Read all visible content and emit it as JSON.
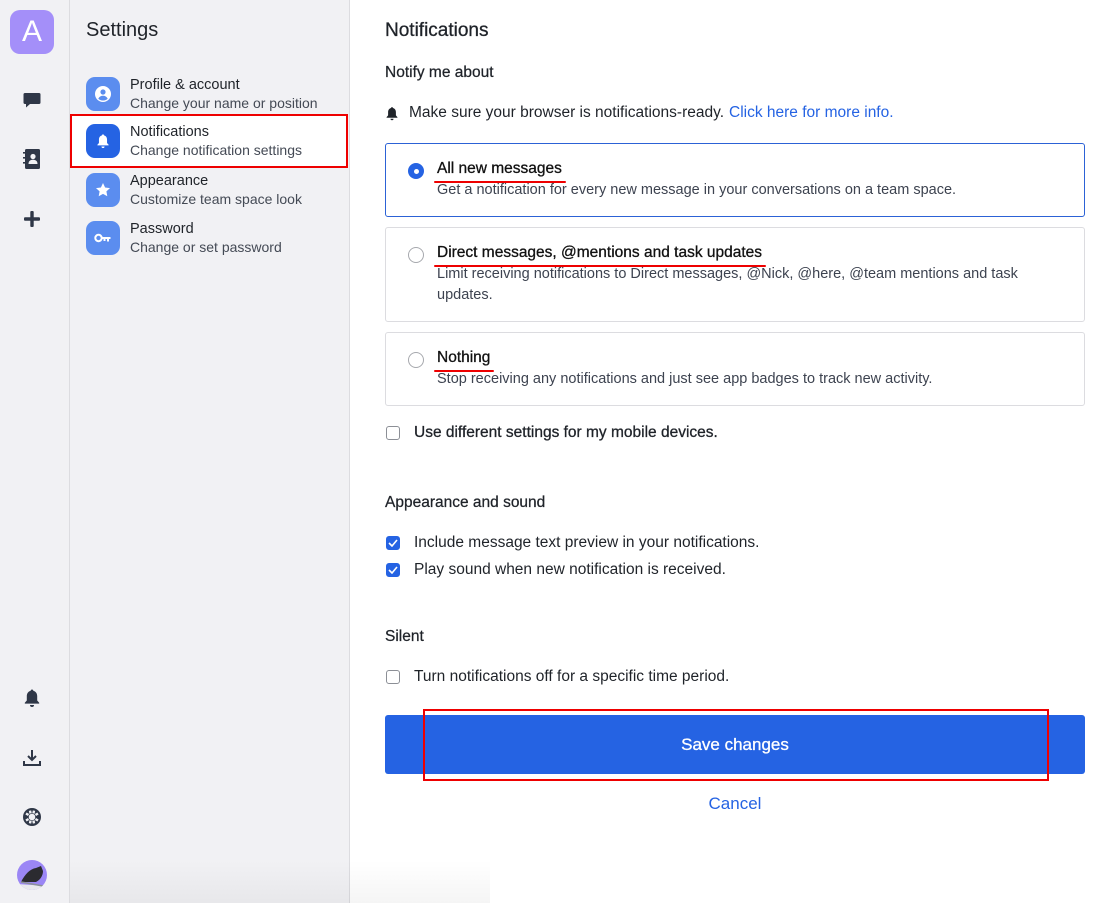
{
  "rail": {
    "workspace_initial": "A",
    "top_icons": [
      "chat-icon",
      "contacts-icon",
      "add-icon"
    ],
    "bottom_icons": [
      "bell-icon",
      "download-icon",
      "help-lifebuoy-icon",
      "user-avatar"
    ]
  },
  "settings": {
    "title": "Settings",
    "items": [
      {
        "label": "Profile & account",
        "sub": "Change your name or position",
        "icon": "user-icon"
      },
      {
        "label": "Notifications",
        "sub": "Change notification settings",
        "icon": "bell-icon",
        "active": true
      },
      {
        "label": "Appearance",
        "sub": "Customize team space look",
        "icon": "star-icon"
      },
      {
        "label": "Password",
        "sub": "Change or set password",
        "icon": "key-icon"
      }
    ]
  },
  "main": {
    "title": "Notifications",
    "notify_heading": "Notify me about",
    "hint_text": "Make sure your browser is notifications-ready.",
    "hint_link": "Click here for more info.",
    "options": [
      {
        "title": "All new messages",
        "desc": "Get a notification for every new message in your conversations on a team space.",
        "selected": true
      },
      {
        "title": "Direct messages, @mentions and task updates",
        "desc": "Limit receiving notifications to Direct messages, @Nick, @here, @team mentions and task updates.",
        "selected": false
      },
      {
        "title": "Nothing",
        "desc": "Stop receiving any notifications and just see app badges to track new activity.",
        "selected": false
      }
    ],
    "mobile_checkbox": {
      "label": "Use different settings for my mobile devices.",
      "checked": false
    },
    "appearance_heading": "Appearance and sound",
    "appearance_checks": [
      {
        "label": "Include message text preview in your notifications.",
        "checked": true
      },
      {
        "label": "Play sound when new notification is received.",
        "checked": true
      }
    ],
    "silent_heading": "Silent",
    "silent_check": {
      "label": "Turn notifications off for a specific time period.",
      "checked": false
    },
    "save_label": "Save changes",
    "cancel_label": "Cancel"
  },
  "colors": {
    "accent": "#2563e3",
    "highlight": "#ee0000",
    "sidebar_bg": "#f1f1f4"
  }
}
